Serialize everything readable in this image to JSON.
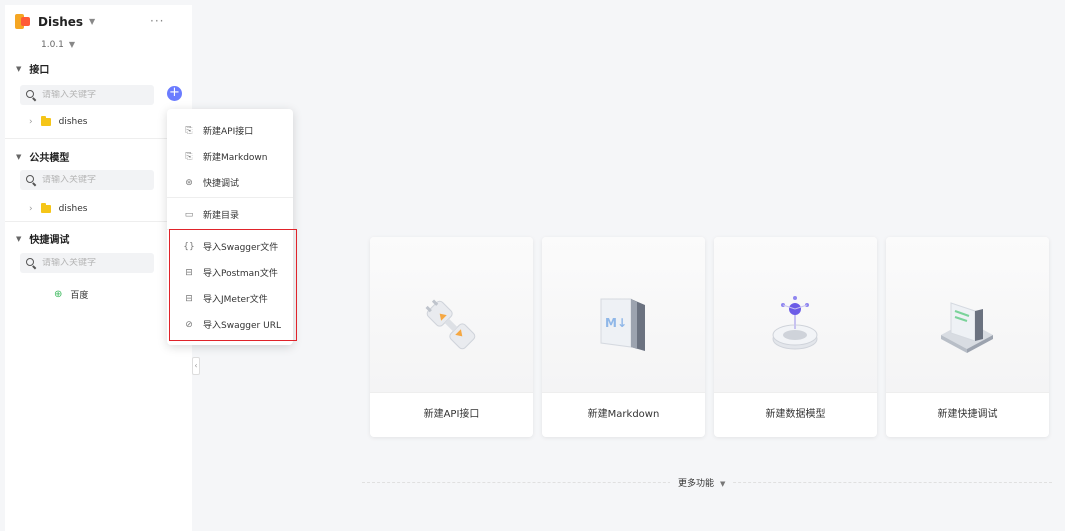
{
  "project": {
    "name": "Dishes",
    "version": "1.0.1",
    "more": "···"
  },
  "sections": {
    "interfaces": {
      "title": "接口",
      "search_placeholder": "请输入关键字",
      "folder": "dishes"
    },
    "models": {
      "title": "公共模型",
      "search_placeholder": "请输入关键字",
      "folder": "dishes"
    },
    "quick_debug": {
      "title": "快捷调试",
      "search_placeholder": "请输入关键字",
      "item": "百度"
    }
  },
  "dropdown": {
    "new_api": "新建API接口",
    "new_markdown": "新建Markdown",
    "quick_debug": "快捷调试",
    "new_folder": "新建目录",
    "import_swagger_file": "导入Swagger文件",
    "import_postman_file": "导入Postman文件",
    "import_jmeter_file": "导入JMeter文件",
    "import_swagger_url": "导入Swagger URL"
  },
  "cards": {
    "api": "新建API接口",
    "markdown": "新建Markdown",
    "model": "新建数据模型",
    "debug": "新建快捷调试"
  },
  "more_functions": "更多功能",
  "colors": {
    "accent": "#6b7cff",
    "highlight_border": "#e0232a",
    "folder": "#f5c518"
  }
}
